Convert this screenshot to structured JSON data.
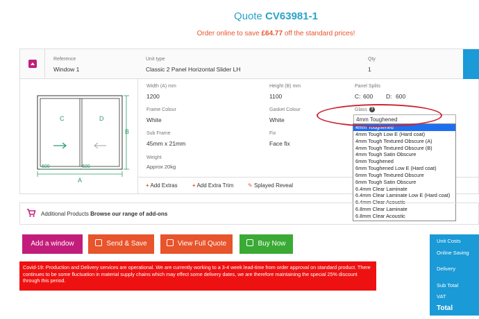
{
  "quote": {
    "prefix": "Quote ",
    "number": "CV63981-1"
  },
  "order_online": {
    "before": "Order online to save ",
    "amount": "£64.77",
    "after": " off the standard prices!"
  },
  "header": {
    "reference_label": "Reference",
    "reference_value": "Window 1",
    "unit_type_label": "Unit type",
    "unit_type_value": "Classic 2 Panel Horizontal Slider LH",
    "qty_label": "Qty",
    "qty_value": "1"
  },
  "drawing": {
    "panel_c": "C",
    "panel_d": "D",
    "dim_600_left": "600",
    "dim_600_right": "600",
    "label_a": "A",
    "label_b": "B"
  },
  "fields": {
    "width_label": "Width (A) mm",
    "width_value": "1200",
    "height_label": "Height (B) mm",
    "height_value": "1100",
    "splits_label": "Panel Splits",
    "split_c_label": "C:",
    "split_c_value": "600",
    "split_d_label": "D:",
    "split_d_value": "600",
    "frame_label": "Frame Colour",
    "frame_value": "White",
    "gasket_label": "Gasket Colour",
    "gasket_value": "White",
    "glass_label": "Glass",
    "glass_value": "4mm Toughened",
    "subframe_label": "Sub Frame",
    "subframe_value": "45mm x 21mm",
    "fix_label": "Fix",
    "fix_value": "Face fix",
    "weight_label": "Weight",
    "weight_value": "Approx 20kg"
  },
  "glass_options": [
    "4mm Toughened",
    "4mm Tough Low E (Hard coat)",
    "4mm Tough Textured Obscure (A)",
    "4mm Tough Textured Obscure (B)",
    "4mm Tough Satin Obscure",
    "6mm Toughened",
    "6mm Toughened Low E (Hard coat)",
    "6mm Tough Textured Obscure",
    "6mm Tough Satin Obscure",
    "6.4mm Clear Laminate",
    "6.4mm Clear Laminate Low E (Hard coat)",
    "6.4mm Clear Acoustic",
    "6.8mm Clear Laminate",
    "6.8mm Clear Acoustic"
  ],
  "extras": {
    "add_extras": "Add Extras",
    "add_extra_trim": "Add Extra Trim",
    "splayed_reveal": "Splayed Reveal"
  },
  "addons": {
    "prefix": "Additional Products ",
    "link": "Browse our range of add-ons"
  },
  "buttons": {
    "add_window": "Add a window",
    "send_save": "Send & Save",
    "view_quote": "View Full Quote",
    "buy_now": "Buy Now"
  },
  "covid_notice": "Covid-19: Production and Delivery services are operational. We are currently working to a 3-4 week lead-time from order approval on standard product. There continues to be some fluctuation in material supply chains which may effect some delivery dates, we are therefore maintaining the special 25% discount through this period.",
  "summary": {
    "unit_costs": "Unit Costs",
    "online_saving": "Online Saving",
    "delivery": "Delivery",
    "sub_total": "Sub Total",
    "vat": "VAT",
    "total": "Total"
  },
  "colors": {
    "brand_blue": "#29a3c7",
    "accent_orange": "#e8542b",
    "magenta": "#c31d7b",
    "green": "#3aaa35",
    "red": "#ee1111",
    "summary_blue": "#1a9ad6"
  }
}
